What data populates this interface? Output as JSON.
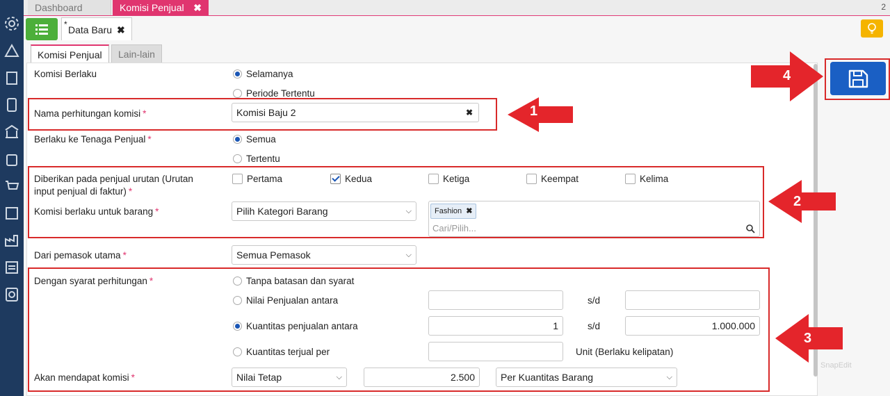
{
  "tabs": {
    "dashboard": "Dashboard",
    "active": "Komisi Penjual",
    "close": "✖",
    "count": "2"
  },
  "doc_tab": {
    "star": "*",
    "label": "Data Baru",
    "close": "✖"
  },
  "inner_tabs": {
    "komisi": "Komisi Penjual",
    "lain": "Lain-lain"
  },
  "form": {
    "komisi_berlaku": {
      "label": "Komisi Berlaku",
      "opt1": "Selamanya",
      "opt2": "Periode Tertentu"
    },
    "nama": {
      "label": "Nama perhitungan komisi",
      "value": "Komisi Baju 2",
      "clear": "✖"
    },
    "tenaga": {
      "label": "Berlaku ke Tenaga Penjual",
      "opt1": "Semua",
      "opt2": "Tertentu"
    },
    "urutan": {
      "label_line1": "Diberikan pada penjual urutan (Urutan",
      "label_line2": "input penjual di faktur)",
      "options": [
        "Pertama",
        "Kedua",
        "Ketiga",
        "Keempat",
        "Kelima"
      ]
    },
    "barang": {
      "label": "Komisi berlaku untuk barang",
      "select": "Pilih Kategori Barang",
      "tag": "Fashion",
      "tag_close": "✖",
      "search_placeholder": "Cari/Pilih..."
    },
    "pemasok": {
      "label": "Dari pemasok utama",
      "select": "Semua Pemasok"
    },
    "syarat": {
      "label": "Dengan syarat perhitungan",
      "opt1": "Tanpa batasan dan syarat",
      "opt2": "Nilai Penjualan antara",
      "opt3": "Kuantitas penjualan antara",
      "opt4": "Kuantitas terjual per",
      "sd": "s/d",
      "qty_from": "1",
      "qty_to": "1.000.000",
      "unit_note": "Unit (Berlaku kelipatan)"
    },
    "komisi": {
      "label": "Akan mendapat komisi",
      "type": "Nilai Tetap",
      "value": "2.500",
      "per": "Per Kuantitas Barang"
    },
    "required_mark": "*"
  },
  "annotations": {
    "n1": "1",
    "n2": "2",
    "n3": "3",
    "n4": "4"
  },
  "watermark": "SnapEdit",
  "colors": {
    "accent": "#e0356f",
    "sidebar": "#1e3a5f",
    "annotation": "#d82a2a",
    "save": "#1a5fc4"
  }
}
